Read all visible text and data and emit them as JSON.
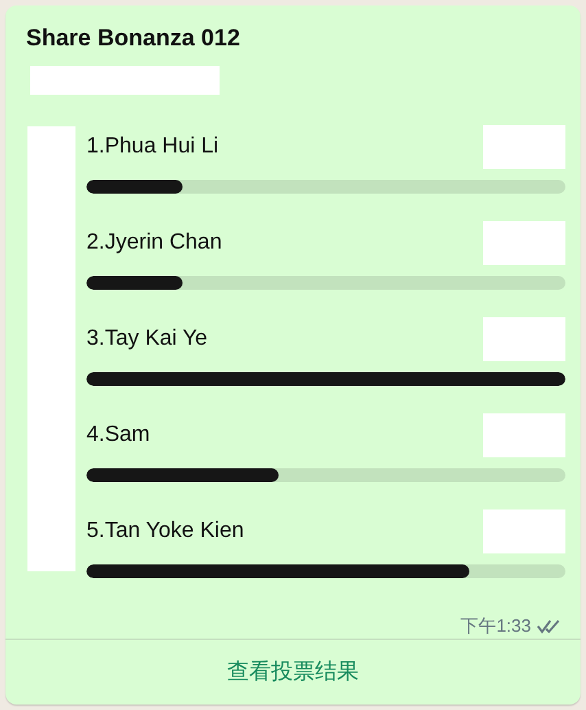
{
  "poll": {
    "title": "Share Bonanza 012",
    "options": [
      {
        "label": "1.Phua Hui Li",
        "level": 0.2
      },
      {
        "label": "2.Jyerin Chan",
        "level": 0.2
      },
      {
        "label": "3.Tay Kai Ye",
        "level": 1.0
      },
      {
        "label": "4.Sam",
        "level": 0.4
      },
      {
        "label": "5.Tan Yoke Kien",
        "level": 0.8
      }
    ],
    "time": "下午1:33",
    "action": "查看投票结果"
  }
}
